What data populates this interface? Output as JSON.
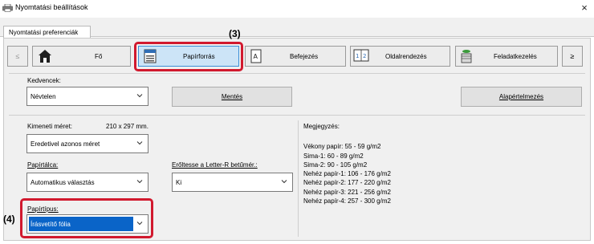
{
  "window": {
    "title": "Nyomtatási beállítások",
    "close": "×"
  },
  "tabs": {
    "preferences": "Nyomtatási preferenciák"
  },
  "nav": {
    "scroll_left": "≤",
    "scroll_right": "≥",
    "items": [
      {
        "label": "Fő",
        "icon": "home-icon"
      },
      {
        "label": "Papírforrás",
        "icon": "paper-tray-icon",
        "selected": true
      },
      {
        "label": "Befejezés",
        "icon": "finishing-icon"
      },
      {
        "label": "Oldalrendezés",
        "icon": "page-layout-icon"
      },
      {
        "label": "Feladatkezelés",
        "icon": "job-handling-icon"
      }
    ]
  },
  "callouts": {
    "three": "(3)",
    "four": "(4)"
  },
  "favorites": {
    "label": "Kedvencek:",
    "value": "Névtelen",
    "save_button": "Mentés",
    "defaults_button": "Alapértelmezés"
  },
  "output_size": {
    "label": "Kimeneti méret:",
    "dimensions": "210 x 297 mm.",
    "value": "Eredetivel azonos méret"
  },
  "paper_tray": {
    "label": "Papírtálca:",
    "value": "Automatikus választás"
  },
  "letter_r": {
    "label": "Erőltesse a Letter-R betűmér.:",
    "value": "Ki"
  },
  "paper_type": {
    "label": "Papírtípus:",
    "value": "Írásvetítő fólia"
  },
  "notes": {
    "label": "Megjegyzés:",
    "lines": [
      "Vékony papír: 55 - 59 g/m2",
      "Sima-1: 60 - 89 g/m2",
      "Sima-2: 90 - 105 g/m2",
      "Nehéz papír-1: 106 - 176 g/m2",
      "Nehéz papír-2: 177 - 220 g/m2",
      "Nehéz papír-3: 221 - 256 g/m2",
      "Nehéz papír-4: 257 - 300 g/m2"
    ]
  },
  "colors": {
    "highlight_red": "#d1192e",
    "selection_blue": "#0a64c8",
    "selected_tab_bg": "#cce4f7"
  }
}
